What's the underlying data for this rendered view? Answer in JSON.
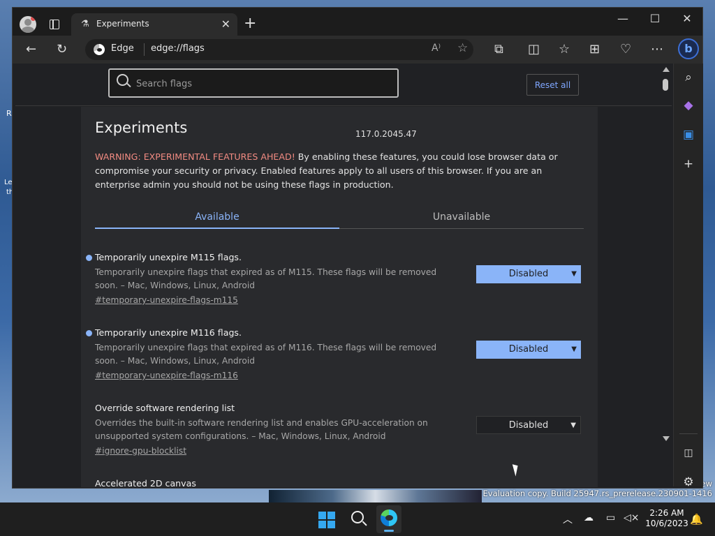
{
  "desktop": {
    "fragments": [
      "R",
      "Le",
      "th",
      "ew"
    ],
    "watermark": "Evaluation copy. Build 25947.rs_prerelease.230901-1416"
  },
  "tab": {
    "title": "Experiments"
  },
  "address": {
    "site": "Edge",
    "url": "edge://flags"
  },
  "header": {
    "search_placeholder": "Search flags",
    "reset_label": "Reset all"
  },
  "page": {
    "title": "Experiments",
    "version": "117.0.2045.47",
    "warning_prefix": "WARNING: EXPERIMENTAL FEATURES AHEAD!",
    "warning_body": " By enabling these features, you could lose browser data or compromise your security or privacy. Enabled features apply to all users of this browser. If you are an enterprise admin you should not be using these flags in production.",
    "tabs": [
      "Available",
      "Unavailable"
    ]
  },
  "flags": [
    {
      "name": "Temporarily unexpire M115 flags.",
      "desc": "Temporarily unexpire flags that expired as of M115. These flags will be removed soon. – Mac, Windows, Linux, Android",
      "link": "#temporary-unexpire-flags-m115",
      "value": "Disabled"
    },
    {
      "name": "Temporarily unexpire M116 flags.",
      "desc": "Temporarily unexpire flags that expired as of M116. These flags will be removed soon. – Mac, Windows, Linux, Android",
      "link": "#temporary-unexpire-flags-m116",
      "value": "Disabled"
    },
    {
      "name": "Override software rendering list",
      "desc": "Overrides the built-in software rendering list and enables GPU-acceleration on unsupported system configurations. – Mac, Windows, Linux, Android",
      "link": "#ignore-gpu-blocklist",
      "value": "Disabled"
    },
    {
      "name": "Accelerated 2D canvas"
    }
  ],
  "taskbar": {
    "time": "2:26 AM",
    "date": "10/6/2023"
  }
}
